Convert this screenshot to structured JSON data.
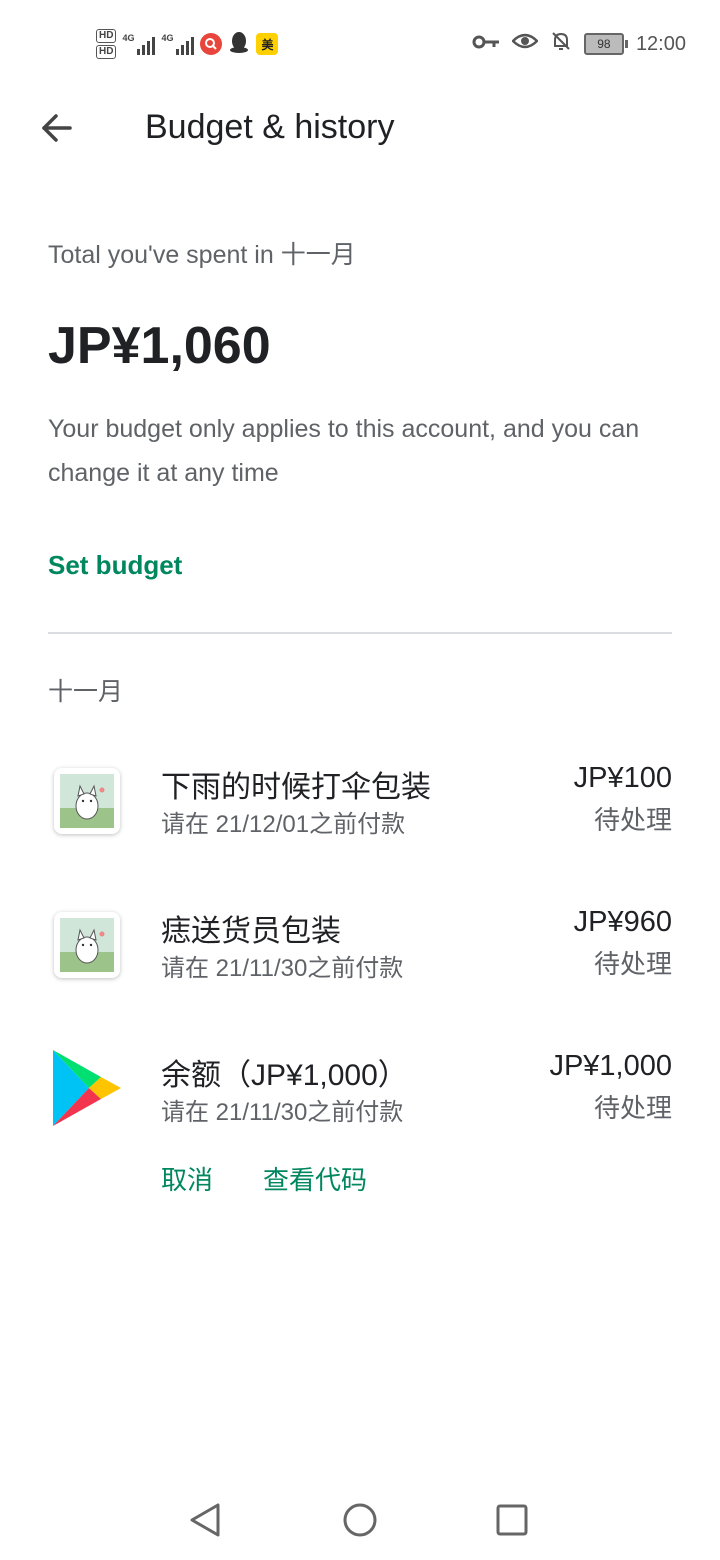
{
  "status_bar": {
    "hd1": "HD",
    "hd2": "HD",
    "net1": "4G",
    "net2": "4G",
    "app_badge": "美",
    "battery": "98",
    "time": "12:00"
  },
  "header": {
    "title": "Budget & history"
  },
  "summary": {
    "label": "Total you've spent in 十一月",
    "amount": "JP¥1,060",
    "note": "Your budget only applies to this account, and you can change it at any time",
    "set_budget": "Set budget"
  },
  "month": "十一月",
  "transactions": [
    {
      "title": "下雨的时候打伞包装",
      "subtitle": "请在 21/12/01之前付款",
      "amount": "JP¥100",
      "status": "待处理",
      "icon": "cat-app-icon"
    },
    {
      "title": "痣送货员包装",
      "subtitle": "请在 21/11/30之前付款",
      "amount": "JP¥960",
      "status": "待处理",
      "icon": "cat-app-icon"
    },
    {
      "title": "余额（JP¥1,000）",
      "subtitle": "请在 21/11/30之前付款",
      "amount": "JP¥1,000",
      "status": "待处理",
      "icon": "google-play-icon",
      "actions": [
        "取消",
        "查看代码"
      ]
    }
  ],
  "colors": {
    "accent": "#01875f",
    "text_primary": "#202124",
    "text_secondary": "#5f6368",
    "divider": "#dadce0"
  }
}
